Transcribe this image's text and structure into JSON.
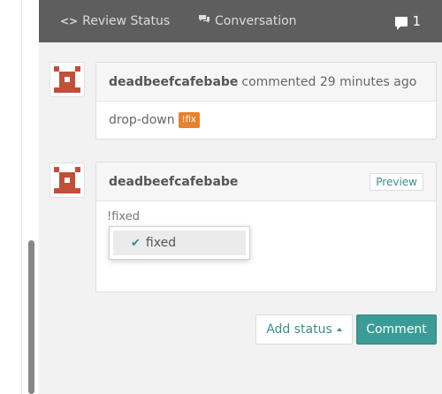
{
  "topbar": {
    "review_tab": {
      "icon": "code-icon",
      "label": "Review Status"
    },
    "conversation_tab": {
      "icon": "comments-icon",
      "label": "Conversation"
    },
    "comment_count": "1"
  },
  "comments": [
    {
      "author": "deadbeefcafebabe",
      "action": "commented 29 minutes ago",
      "body": "drop-down",
      "badge": "!fix"
    }
  ],
  "reply": {
    "author": "deadbeefcafebabe",
    "preview_label": "Preview",
    "editor_text": "!fixed",
    "suggestion": {
      "icon": "check-icon",
      "label": "fixed"
    }
  },
  "actions": {
    "add_status_label": "Add status",
    "comment_label": "Comment"
  },
  "colors": {
    "accent": "#3a9c94",
    "badge": "#e8822e",
    "avatar": "#c0503a",
    "topbar": "#5e5e5e"
  }
}
